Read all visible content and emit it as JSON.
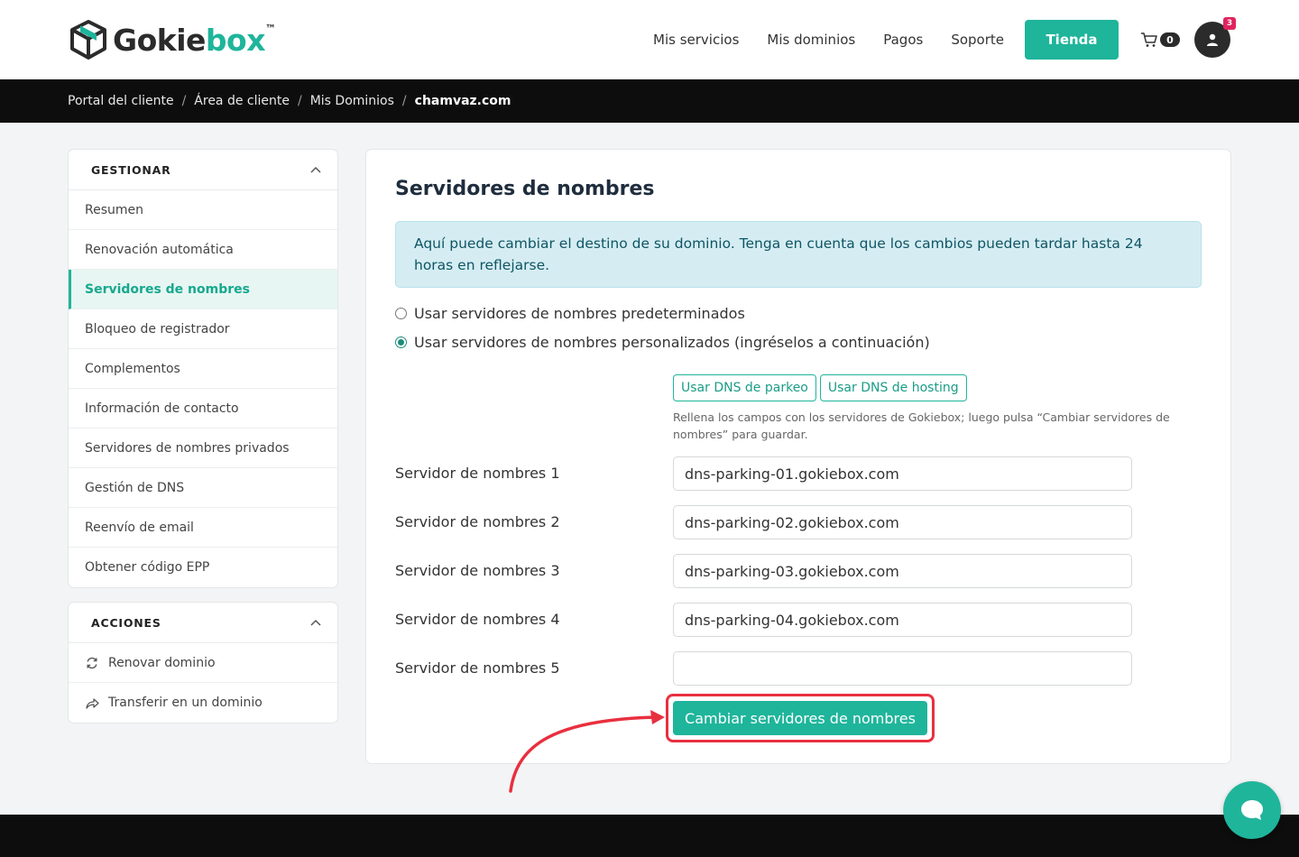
{
  "brand": {
    "name_part1": "Gokie",
    "name_part2": "box",
    "trademark": "™"
  },
  "nav": {
    "links": [
      "Mis servicios",
      "Mis dominios",
      "Pagos",
      "Soporte"
    ],
    "cta_label": "Tienda",
    "cart_count": "0",
    "notifications_count": "3"
  },
  "breadcrumb": [
    "Portal del cliente",
    "Área de cliente",
    "Mis Dominios",
    "chamvaz.com"
  ],
  "sidebar": {
    "manage": {
      "title": "GESTIONAR",
      "items": [
        "Resumen",
        "Renovación automática",
        "Servidores de nombres",
        "Bloqueo de registrador",
        "Complementos",
        "Información de contacto",
        "Servidores de nombres privados",
        "Gestión de DNS",
        "Reenvío de email",
        "Obtener código EPP"
      ],
      "active_index": 2
    },
    "actions": {
      "title": "ACCIONES",
      "items": [
        "Renovar dominio",
        "Transferir en un dominio"
      ]
    }
  },
  "main": {
    "title": "Servidores de nombres",
    "alert": "Aquí puede cambiar el destino de su dominio. Tenga en cuenta que los cambios pueden tardar hasta 24 horas en reflejarse.",
    "options": [
      "Usar servidores de nombres predeterminados",
      "Usar servidores de nombres personalizados (ingréselos a continuación)"
    ],
    "selected_option": 1,
    "dns_buttons": [
      "Usar DNS de parkeo",
      "Usar DNS de hosting"
    ],
    "help_text": "Rellena los campos con los servidores de Gokiebox; luego pulsa “Cambiar servidores de nombres” para guardar.",
    "nameservers": [
      {
        "label": "Servidor de nombres 1",
        "value": "dns-parking-01.gokiebox.com"
      },
      {
        "label": "Servidor de nombres 2",
        "value": "dns-parking-02.gokiebox.com"
      },
      {
        "label": "Servidor de nombres 3",
        "value": "dns-parking-03.gokiebox.com"
      },
      {
        "label": "Servidor de nombres 4",
        "value": "dns-parking-04.gokiebox.com"
      },
      {
        "label": "Servidor de nombres 5",
        "value": ""
      }
    ],
    "submit_label": "Cambiar servidores de nombres"
  },
  "colors": {
    "accent": "#1fb59b",
    "highlight": "#e8303f",
    "dark": "#0d0d0d"
  }
}
